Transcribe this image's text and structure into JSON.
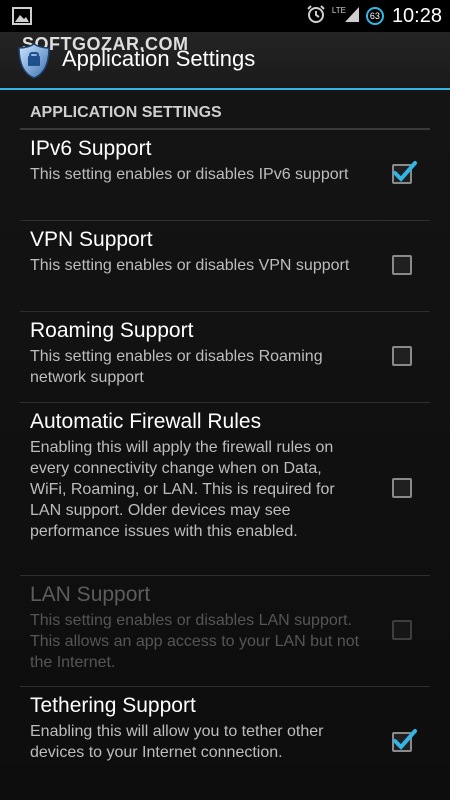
{
  "status_bar": {
    "time": "10:28",
    "battery_level": "63",
    "network_type": "LTE",
    "icons": [
      "image-notification-icon",
      "alarm-icon",
      "signal-icon",
      "battery-icon"
    ]
  },
  "action_bar": {
    "title": "Application Settings",
    "watermark": "SOFTGOZAR.COM",
    "icon": "shield-app-icon"
  },
  "section": {
    "header": "APPLICATION SETTINGS"
  },
  "preferences": [
    {
      "title": "IPv6 Support",
      "summary": "This setting enables or disables IPv6 support",
      "checked": true,
      "enabled": true
    },
    {
      "title": "VPN Support",
      "summary": "This setting enables or disables VPN support",
      "checked": false,
      "enabled": true
    },
    {
      "title": "Roaming Support",
      "summary": "This setting enables or disables Roaming network support",
      "checked": false,
      "enabled": true
    },
    {
      "title": "Automatic Firewall Rules",
      "summary": "Enabling this will apply the firewall rules on every connectivity change when on Data, WiFi, Roaming, or LAN. This is required for LAN support. Older devices may see performance issues with this enabled.",
      "checked": false,
      "enabled": true
    },
    {
      "title": "LAN Support",
      "summary": "This setting enables or disables LAN support. This allows an app access to your LAN but not the Internet.",
      "checked": false,
      "enabled": false
    },
    {
      "title": "Tethering Support",
      "summary": "Enabling this will allow you to tether other devices to your Internet connection.",
      "checked": true,
      "enabled": true
    }
  ],
  "colors": {
    "accent": "#33b5e5",
    "background": "#0b0b0b",
    "summary_text": "#bdbdbd"
  }
}
